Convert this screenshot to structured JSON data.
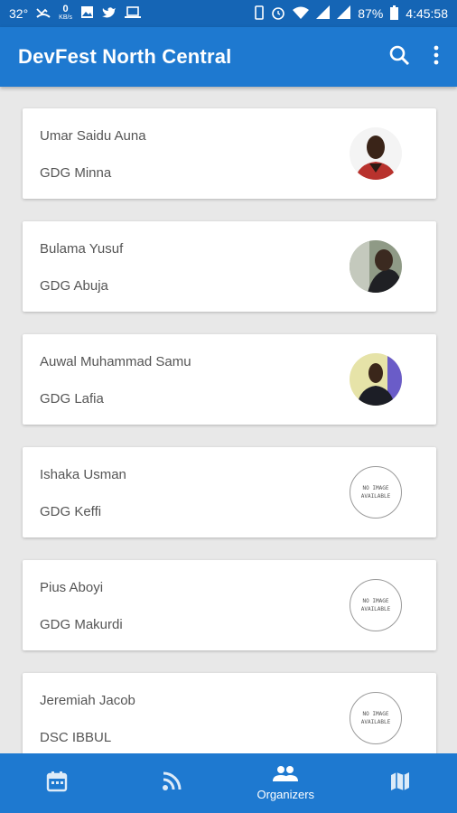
{
  "status_bar": {
    "temperature": "32°",
    "net_speed": "0",
    "net_unit": "KB/s",
    "battery": "87%",
    "time": "4:45:58"
  },
  "app_bar": {
    "title": "DevFest North Central",
    "search_icon": "search-icon",
    "more_icon": "more-vert-icon"
  },
  "organizers": [
    {
      "name": "Umar Saidu Auna",
      "group": "GDG Minna",
      "photo": true
    },
    {
      "name": "Bulama Yusuf",
      "group": "GDG Abuja",
      "photo": true
    },
    {
      "name": "Auwal Muhammad Samu",
      "group": "GDG Lafia",
      "photo": true
    },
    {
      "name": "Ishaka Usman",
      "group": "GDG Keffi",
      "photo": false,
      "placeholder_line1": "NO IMAGE",
      "placeholder_line2": "AVAILABLE"
    },
    {
      "name": "Pius Aboyi",
      "group": "GDG Makurdi",
      "photo": false,
      "placeholder_line1": "NO IMAGE",
      "placeholder_line2": "AVAILABLE"
    },
    {
      "name": "Jeremiah Jacob",
      "group": "DSC IBBUL",
      "photo": false,
      "placeholder_line1": "NO IMAGE",
      "placeholder_line2": "AVAILABLE"
    }
  ],
  "bottom_nav": {
    "items": [
      {
        "icon": "calendar-icon",
        "label": ""
      },
      {
        "icon": "rss-feed-icon",
        "label": ""
      },
      {
        "icon": "people-icon",
        "label": "Organizers"
      },
      {
        "icon": "map-icon",
        "label": ""
      }
    ],
    "active_index": 2
  },
  "colors": {
    "status_bar": "#1565b5",
    "app_bar": "#1e79d0",
    "background": "#e8e8e8"
  }
}
